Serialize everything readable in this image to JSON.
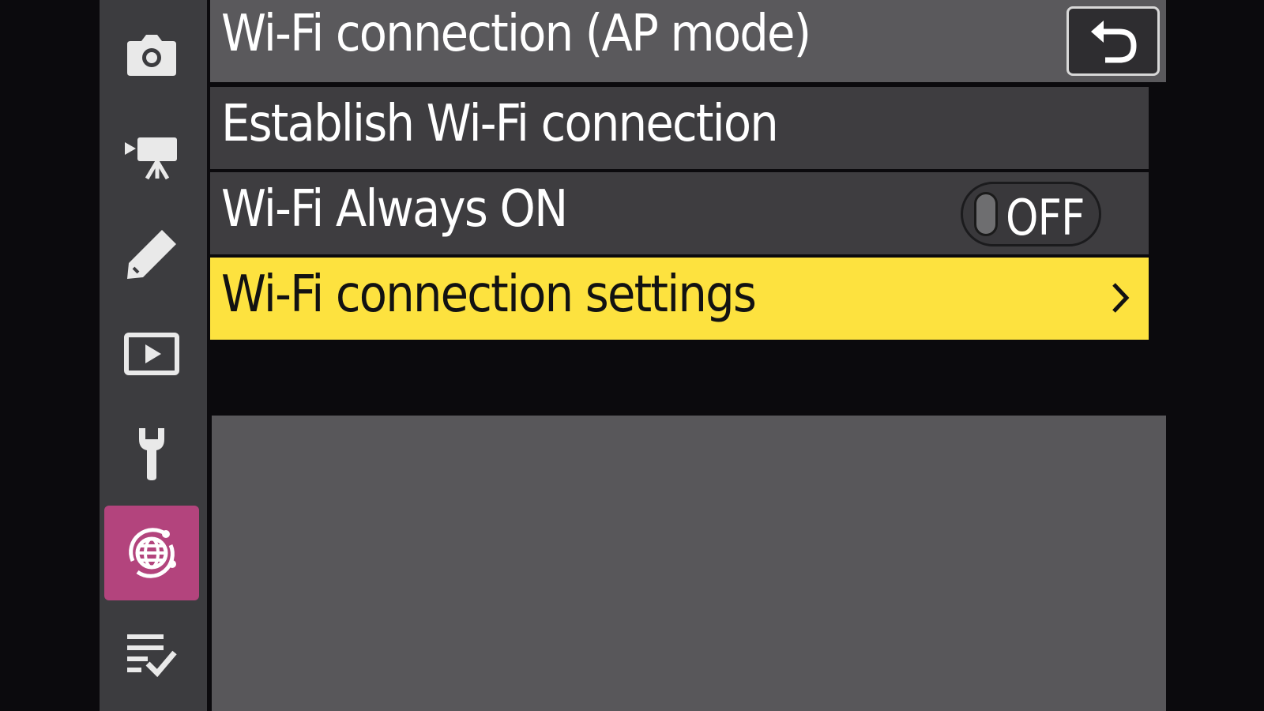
{
  "header": {
    "title": "Wi-Fi connection (AP mode)",
    "back_icon": "return-arrow-icon"
  },
  "rail": {
    "tabs": [
      {
        "icon": "camera-icon",
        "active": false
      },
      {
        "icon": "movie-camera-icon",
        "active": false
      },
      {
        "icon": "pencil-icon",
        "active": false
      },
      {
        "icon": "playback-icon",
        "active": false
      },
      {
        "icon": "wrench-icon",
        "active": false
      },
      {
        "icon": "network-globe-icon",
        "active": true
      },
      {
        "icon": "my-menu-checklist-icon",
        "active": false
      }
    ]
  },
  "menu": {
    "items": [
      {
        "label": "Establish Wi-Fi connection"
      },
      {
        "label": "Wi-Fi Always ON",
        "value": "OFF"
      },
      {
        "label": "Wi-Fi connection settings",
        "selected": true
      }
    ]
  },
  "colors": {
    "selected_row": "#fde23f",
    "active_tab": "#b3447d",
    "row_bg": "#3e3d40",
    "header_bg": "#5a595c",
    "rail_bg": "#3c3c3f"
  }
}
